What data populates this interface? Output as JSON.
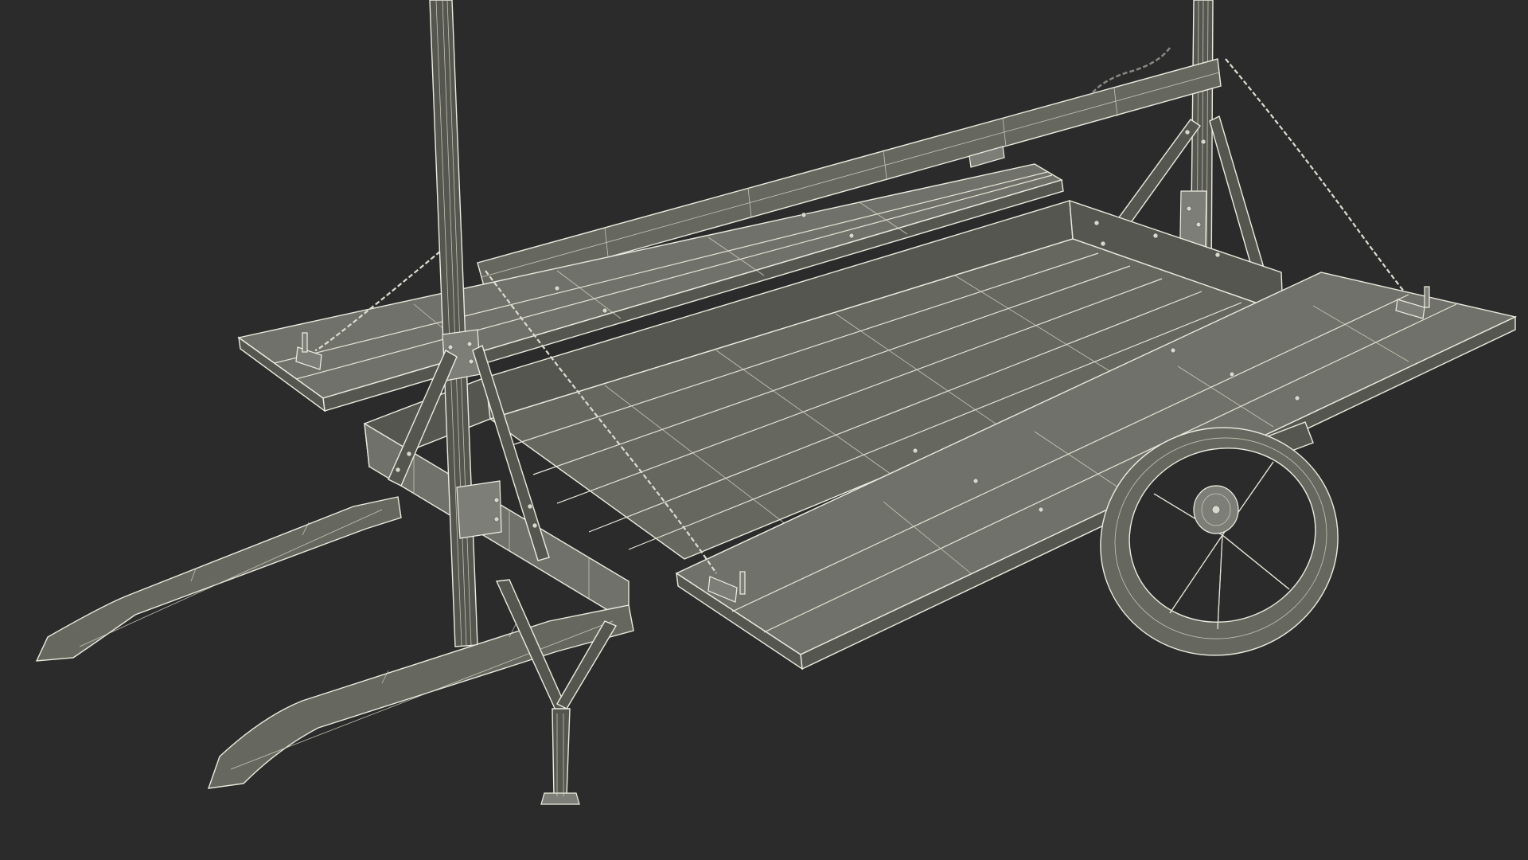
{
  "scene": {
    "subject": "",
    "background_color": "#2b2b2b",
    "wire_color": "#e6e4d6",
    "surface_color": "#66675f"
  }
}
